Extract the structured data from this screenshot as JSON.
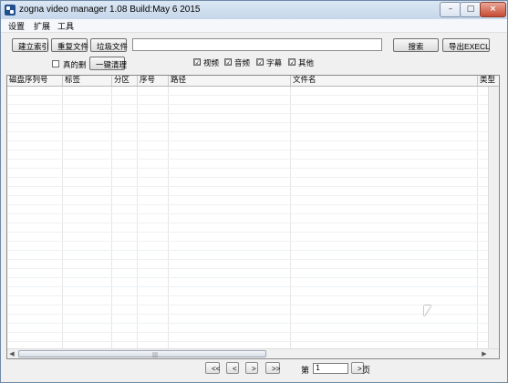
{
  "window": {
    "title": "zogna video manager 1.08 Build:May  6 2015",
    "controls": {
      "minimize": "–",
      "maximize": "□",
      "close": "×"
    }
  },
  "menu": [
    "设置",
    "扩展",
    "工具"
  ],
  "toolbar": {
    "build_index": "建立索引",
    "duplicate_files": "重复文件",
    "junk_files": "垃圾文件",
    "search_placeholder": "",
    "search": "搜索",
    "export_excel": "导出EXECL",
    "real_delete": {
      "label": "真的删",
      "checked": false
    },
    "one_click_clean": "一键清理",
    "filters": [
      {
        "label": "视频",
        "checked": true
      },
      {
        "label": "音频",
        "checked": true
      },
      {
        "label": "字幕",
        "checked": true
      },
      {
        "label": "其他",
        "checked": true
      }
    ]
  },
  "grid": {
    "columns": [
      "磁盘序列号",
      "标签",
      "分区",
      "序号",
      "路径",
      "文件名",
      "类型"
    ],
    "rows": []
  },
  "pager": {
    "first": "<<",
    "prev": "<",
    "next": ">",
    "last": ">>",
    "page_label": "第",
    "page_value": "1",
    "go": ">",
    "page_suffix": "页"
  },
  "icons": {
    "app": "app-icon",
    "check": "☑"
  }
}
